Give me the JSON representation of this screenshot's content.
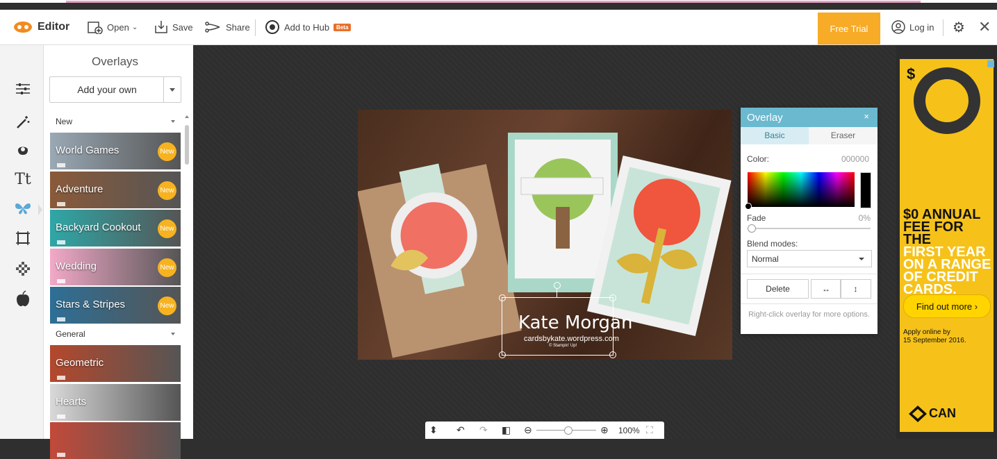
{
  "toolbar": {
    "logo_label": "Editor",
    "open_label": "Open",
    "save_label": "Save",
    "share_label": "Share",
    "hub_label": "Add to Hub",
    "beta_label": "Beta",
    "free_trial_label": "Free Trial",
    "login_label": "Log in"
  },
  "tools": [
    "adjust-icon",
    "magic-wand-icon",
    "touch-up-icon",
    "text-icon",
    "butterfly-icon",
    "frame-icon",
    "texture-icon",
    "apple-icon"
  ],
  "panel": {
    "title": "Overlays",
    "add_your_own": "Add your own",
    "new_section": "New",
    "general_section": "General",
    "new_badge": "New",
    "items_new": [
      {
        "label": "World Games",
        "bg": "#9aa9b5"
      },
      {
        "label": "Adventure",
        "bg": "#8a5a3a"
      },
      {
        "label": "Backyard Cookout",
        "bg": "#2fa7a7"
      },
      {
        "label": "Wedding",
        "bg": "#f2a9c8"
      },
      {
        "label": "Stars & Stripes",
        "bg": "#2e6f96"
      }
    ],
    "items_general": [
      {
        "label": "Geometric",
        "bg": "#b4482c"
      },
      {
        "label": "Hearts",
        "bg": "#d9d9d9"
      },
      {
        "label": "",
        "bg": "#c24a3a"
      }
    ]
  },
  "watermark": {
    "name": "Kate Morgan",
    "site": "cardsbykate.wordpress.com",
    "credit": "© Stampin' Up!"
  },
  "overlay_panel": {
    "title": "Overlay",
    "close": "×",
    "tab_basic": "Basic",
    "tab_eraser": "Eraser",
    "color_label": "Color:",
    "color_value": "000000",
    "fade_label": "Fade",
    "fade_value": "0%",
    "blend_label": "Blend modes:",
    "blend_value": "Normal",
    "delete_label": "Delete",
    "flip_h": "↔",
    "flip_v": "↕",
    "hint": "Right-click overlay for more options."
  },
  "ad": {
    "dollar": "$",
    "line1": "$0 ANNUAL",
    "line2": "FEE FOR THE",
    "line3": "FIRST YEAR",
    "line4": "ON A RANGE",
    "line5": "OF CREDIT",
    "line6": "CARDS.",
    "button": "Find out more ›",
    "small1": "Apply online by",
    "small2": "15 September 2016.",
    "brand": "CAN"
  },
  "bottom": {
    "zoom": "100%"
  },
  "colors": {
    "accent": "#6ab9cf",
    "free_trial": "#f7ab27",
    "canvas": "#2e2e2e"
  }
}
